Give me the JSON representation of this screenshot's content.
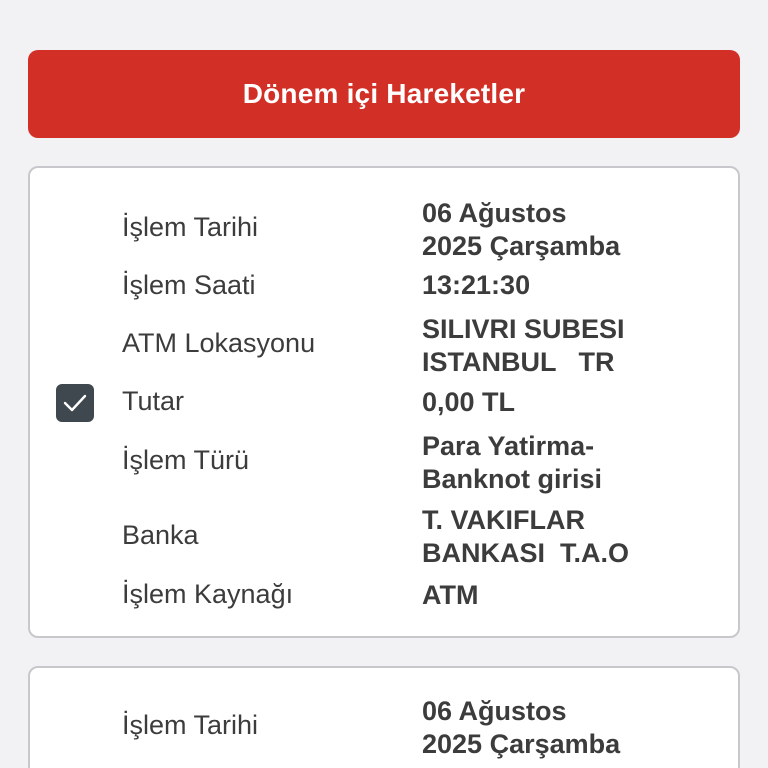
{
  "colors": {
    "header_bg": "#d22f26",
    "checkbox_bg": "#3f474f"
  },
  "header": {
    "title": "Dönem içi Hareketler"
  },
  "cards": [
    {
      "selected": true,
      "rows": [
        {
          "label": "İşlem Tarihi",
          "value": "06 Ağustos\n2025 Çarşamba"
        },
        {
          "label": "İşlem Saati",
          "value": "13:21:30"
        },
        {
          "label": "ATM Lokasyonu",
          "value": "SILIVRI SUBESI\nISTANBUL   TR"
        },
        {
          "label": "Tutar",
          "value": "0,00 TL"
        },
        {
          "label": "İşlem Türü",
          "value": "Para Yatirma-\nBanknot girisi"
        },
        {
          "label": "Banka",
          "value": "T. VAKIFLAR\nBANKASI  T.A.O"
        },
        {
          "label": "İşlem Kaynağı",
          "value": "ATM"
        }
      ]
    },
    {
      "selected": false,
      "rows": [
        {
          "label": "İşlem Tarihi",
          "value": "06 Ağustos\n2025 Çarşamba"
        }
      ]
    }
  ]
}
